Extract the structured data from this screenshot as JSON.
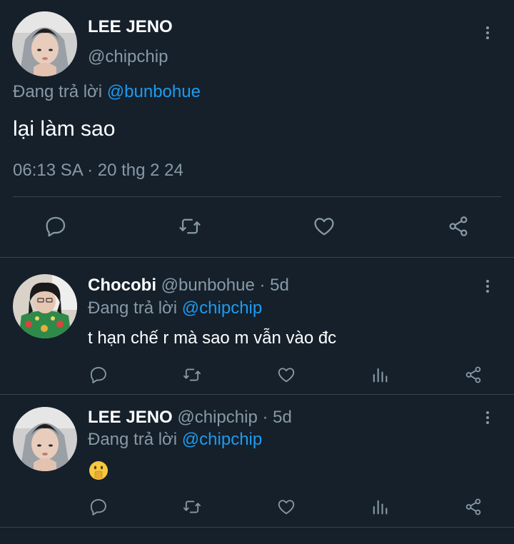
{
  "main_tweet": {
    "author_name": "LEE JENO",
    "handle": "@chipchip",
    "reply_prefix": "Đang trả lời",
    "reply_to": "@bunbohue",
    "text": "lại làm sao",
    "timestamp": "06:13 SA · 20 thg 2 24",
    "actions": [
      "reply-icon",
      "retweet-icon",
      "like-icon",
      "share-icon"
    ]
  },
  "replies": [
    {
      "author_name": "Chocobi",
      "handle": "@bunbohue",
      "age": "· 5d",
      "reply_prefix": "Đang trả lời",
      "reply_to": "@chipchip",
      "text": "t hạn chế r mà sao m vẫn vào đc",
      "actions": [
        "reply-icon",
        "retweet-icon",
        "like-icon",
        "analytics-icon",
        "share-icon"
      ]
    },
    {
      "author_name": "LEE JENO",
      "handle": "@chipchip",
      "age": "· 5d",
      "reply_prefix": "Đang trả lời",
      "reply_to": "@chipchip",
      "text": "🫢",
      "actions": [
        "reply-icon",
        "retweet-icon",
        "like-icon",
        "analytics-icon",
        "share-icon"
      ]
    }
  ],
  "colors": {
    "background": "#15202b",
    "text_primary": "#ffffff",
    "text_secondary": "#8899a6",
    "accent": "#1d9bf0",
    "divider": "#38444d"
  }
}
